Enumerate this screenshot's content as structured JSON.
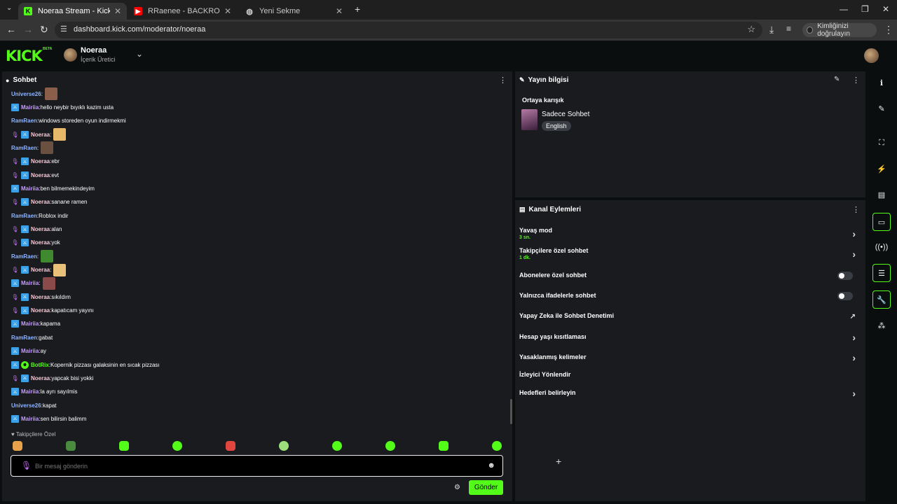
{
  "browser": {
    "tabs": [
      {
        "title": "Noeraa Stream - Kick Dashboar"
      },
      {
        "title": "RRaenee - BACKROOMS TÜM"
      },
      {
        "title": "Yeni Sekme"
      }
    ],
    "url": "dashboard.kick.com/moderator/noeraa",
    "profile_label": "Kimliğinizi doğrulayın"
  },
  "header": {
    "logo": "KICK",
    "beta": "BETA",
    "user_name": "Noeraa",
    "user_role": "İçerik Üretici"
  },
  "chat": {
    "title": "Sohbet",
    "messages": [
      {
        "user": "Universe26",
        "text": "",
        "color": "#8fb4ff"
      },
      {
        "user": "Mairiia",
        "text": "hello neybir bıyıklı kazim usta",
        "color": "#c79bff"
      },
      {
        "user": "RamRaen",
        "text": "windows storeden oyun indirmekmi",
        "color": "#8fb4ff"
      },
      {
        "user": "Noeraa",
        "text": "",
        "color": "#f7c6d2"
      },
      {
        "user": "RamRaen",
        "text": "",
        "color": "#8fb4ff"
      },
      {
        "user": "Noeraa",
        "text": "ebr",
        "color": "#f7c6d2"
      },
      {
        "user": "Noeraa",
        "text": "evt",
        "color": "#f7c6d2"
      },
      {
        "user": "Mairiia",
        "text": "ben bilmemekindeyim",
        "color": "#c79bff"
      },
      {
        "user": "Noeraa",
        "text": "sanane ramen",
        "color": "#f7c6d2"
      },
      {
        "user": "RamRaen",
        "text": "Roblox indir",
        "color": "#8fb4ff"
      },
      {
        "user": "Noeraa",
        "text": "alan",
        "color": "#f7c6d2"
      },
      {
        "user": "Noeraa",
        "text": "yok",
        "color": "#f7c6d2"
      },
      {
        "user": "RamRaen",
        "text": "",
        "color": "#8fb4ff"
      },
      {
        "user": "Noeraa",
        "text": "",
        "color": "#f7c6d2"
      },
      {
        "user": "Mairiia",
        "text": "",
        "color": "#c79bff"
      },
      {
        "user": "Noeraa",
        "text": "sıkıldım",
        "color": "#f7c6d2"
      },
      {
        "user": "Noeraa",
        "text": "kapatıcam yayını",
        "color": "#f7c6d2"
      },
      {
        "user": "Mairiia",
        "text": "kapama",
        "color": "#c79bff"
      },
      {
        "user": "RamRaen",
        "text": "gabat",
        "color": "#8fb4ff"
      },
      {
        "user": "Mairiia",
        "text": "ay",
        "color": "#c79bff"
      },
      {
        "user": "BotRix",
        "text": "Kopernik pizzası galaksinin en sıcak pizzası",
        "color": "#53fc18"
      },
      {
        "user": "Noeraa",
        "text": "yapcak bisi yokki",
        "color": "#f7c6d2"
      },
      {
        "user": "Mairiia",
        "text": "la ayrı sayılmis",
        "color": "#c79bff"
      },
      {
        "user": "Universe26",
        "text": "kapat",
        "color": "#8fb4ff"
      },
      {
        "user": "Mairiia",
        "text": "sen bilirsin balimm",
        "color": "#c79bff"
      }
    ],
    "followers_only_label": "Takipçilere Özel",
    "input_placeholder": "Bir mesaj gönderin",
    "send_label": "Gönder"
  },
  "stream_info": {
    "title": "Yayın bilgisi",
    "category": "Ortaya karışık",
    "stream_title": "Sadece Sohbet",
    "language": "English"
  },
  "channel_actions": {
    "title": "Kanal Eylemleri",
    "items": [
      {
        "label": "Yavaş mod",
        "sub": "3 sn."
      },
      {
        "label": "Takipçilere özel sohbet",
        "sub": "1 dk."
      },
      {
        "label": "Abonelere özel sohbet",
        "sub": ""
      },
      {
        "label": "Yalnızca ifadelerle sohbet",
        "sub": ""
      },
      {
        "label": "Yapay Zeka ile Sohbet Denetimi",
        "sub": ""
      },
      {
        "label": "Hesap yaşı kısıtlaması",
        "sub": ""
      },
      {
        "label": "Yasaklanmış kelimeler",
        "sub": ""
      },
      {
        "label": "İzleyici Yönlendir",
        "sub": ""
      },
      {
        "label": "Hedefleri belirleyin",
        "sub": ""
      }
    ]
  },
  "colors": {
    "accent": "#53fc18",
    "panel": "#191b1f",
    "background": "#0b0e0f"
  }
}
